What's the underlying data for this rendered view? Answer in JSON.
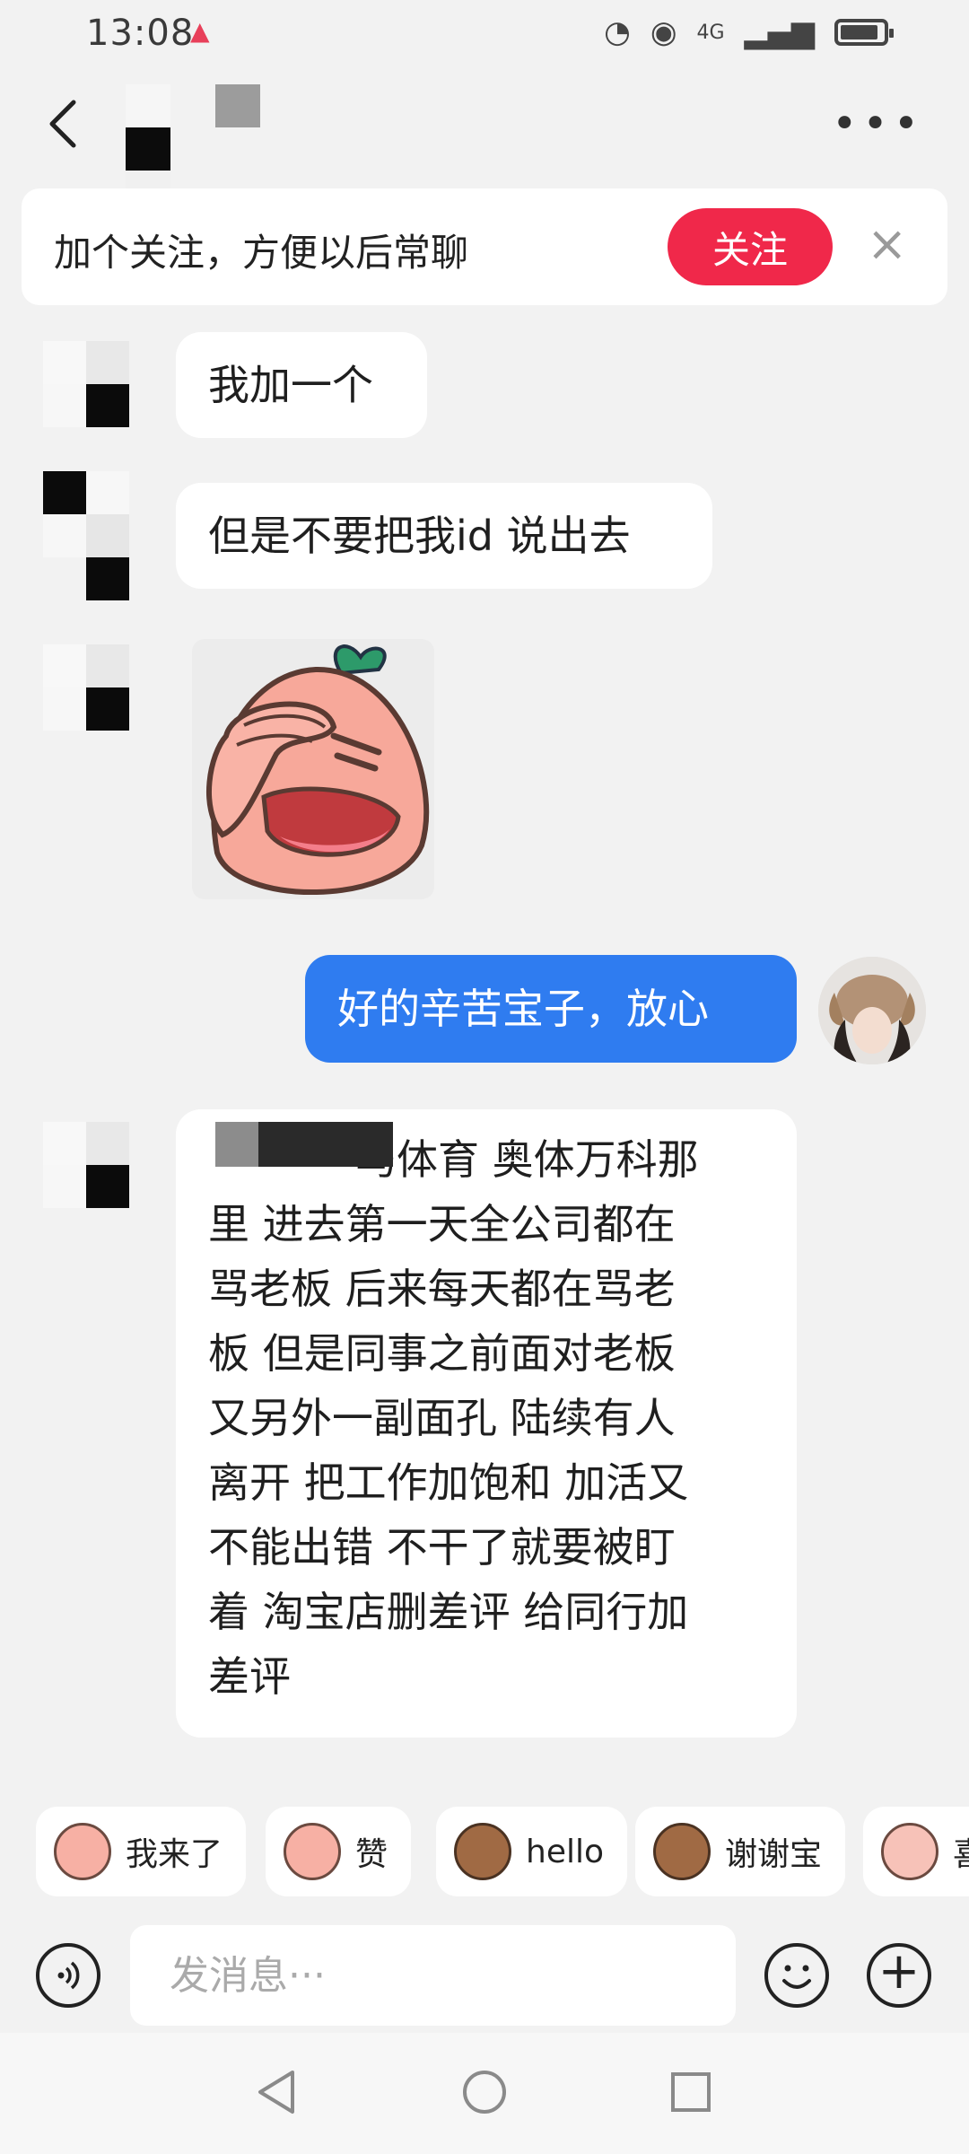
{
  "status_bar": {
    "time": "13:08",
    "network": "4G"
  },
  "header": {
    "title": "",
    "more_label": "•••"
  },
  "follow_prompt": {
    "text": "加个关注，方便以后常聊",
    "button_label": "关注",
    "close_label": "×"
  },
  "messages": [
    {
      "sender": "other",
      "type": "text",
      "text": "我加一个"
    },
    {
      "sender": "other",
      "type": "text",
      "text": "但是不要把我id 说出去"
    },
    {
      "sender": "other",
      "type": "sticker",
      "sticker": "facepalm-peach-sticker"
    },
    {
      "sender": "me",
      "type": "text",
      "text": "好的辛苦宝子，放心"
    },
    {
      "sender": "other",
      "type": "text",
      "lines": [
        "马体育 奥体万科那",
        "里 进去第一天全公司都在",
        "骂老板 后来每天都在骂老",
        "板 但是同事之前面对老板",
        "又另外一副面孔 陆续有人",
        "离开 把工作加饱和 加活又",
        "不能出错 不干了就要被盯",
        "着 淘宝店删差评 给同行加",
        "差评"
      ]
    }
  ],
  "quick_replies": [
    {
      "label": "我来了"
    },
    {
      "label": "赞"
    },
    {
      "label": "hello"
    },
    {
      "label": "谢谢宝"
    },
    {
      "label": "喜"
    }
  ],
  "input": {
    "placeholder": "发消息···"
  },
  "colors": {
    "accent_red": "#f0284a",
    "my_bubble": "#2f7cf0",
    "background": "#f2f2f2"
  }
}
